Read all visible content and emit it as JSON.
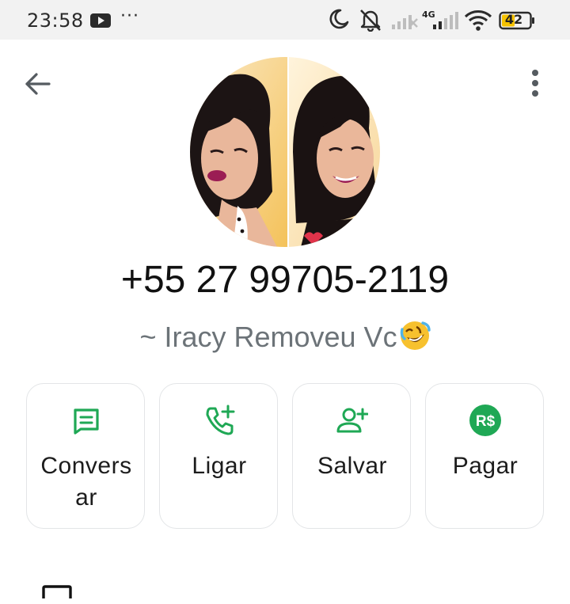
{
  "status_bar": {
    "time": "23:58",
    "dots": "···",
    "network_label": "4G",
    "battery": "42"
  },
  "contact": {
    "phone": "+55 27 99705-2119",
    "about": "~ Iracy Removeu Vc"
  },
  "actions": [
    {
      "label": "Convers\nar",
      "icon": "message-icon"
    },
    {
      "label": "Ligar",
      "icon": "phone-add-icon"
    },
    {
      "label": "Salvar",
      "icon": "person-add-icon"
    },
    {
      "label": "Pagar",
      "icon": "brl-payment-icon"
    }
  ],
  "pay_icon_text": "R$",
  "colors": {
    "accent": "#1fa855",
    "status_bar_bg": "#f2f2f2",
    "text_primary": "#111111",
    "text_secondary": "#6c7378",
    "card_border": "#e3e5e7"
  }
}
